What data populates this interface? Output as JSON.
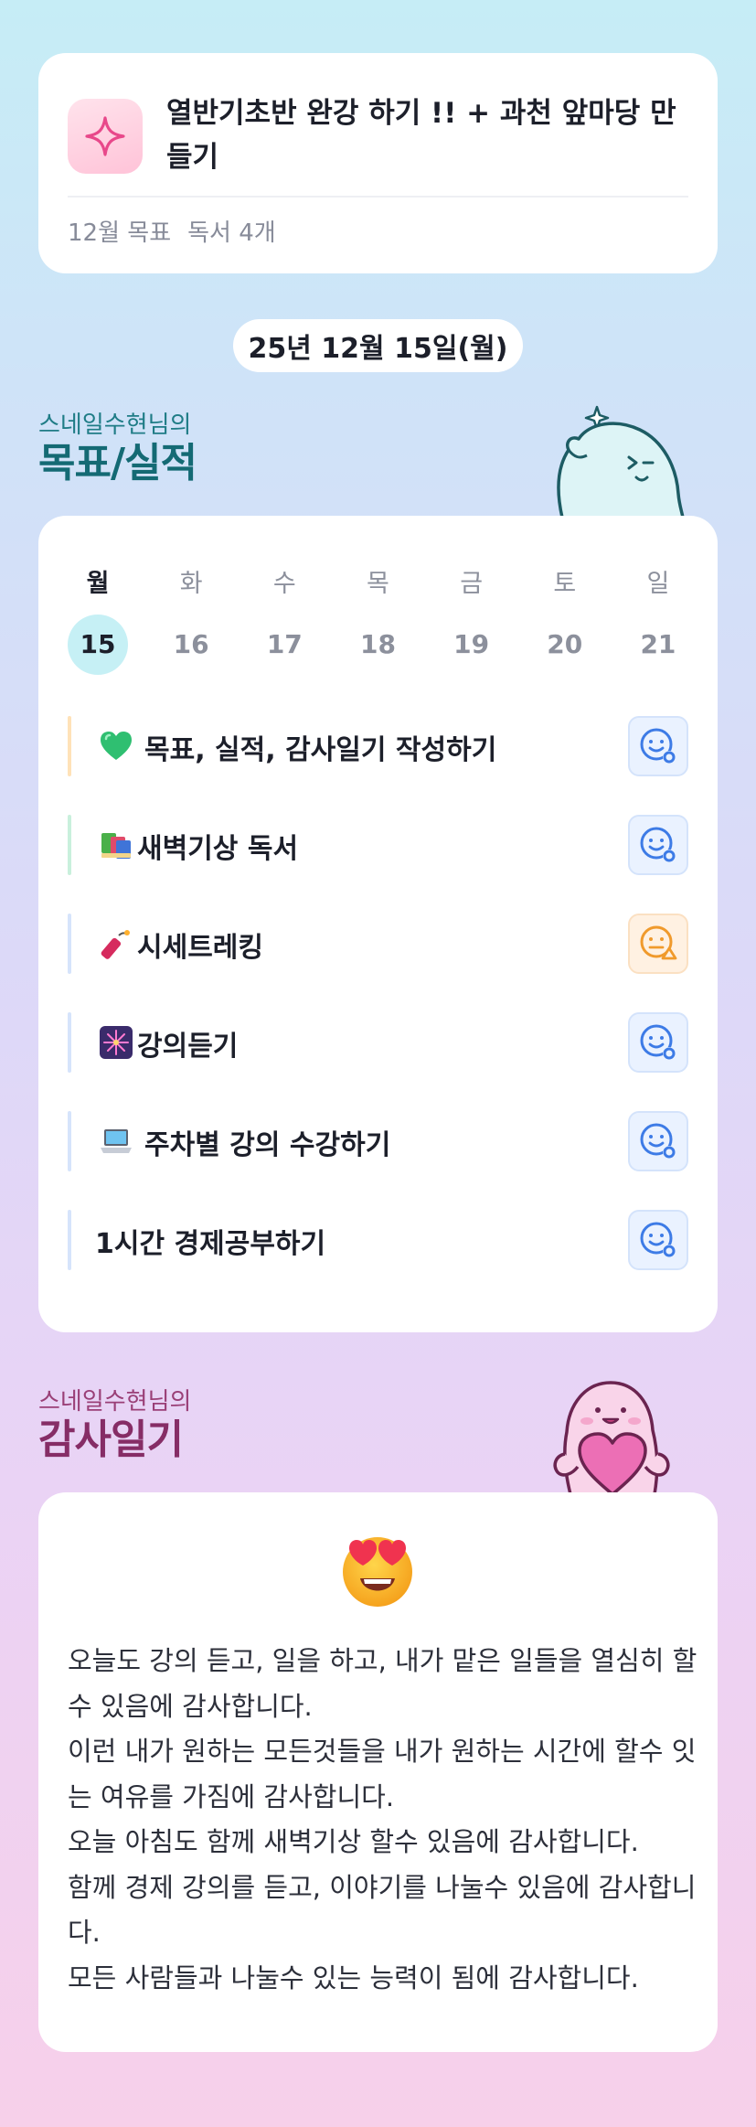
{
  "goal": {
    "icon": "sparkle-icon",
    "title": "열반기초반 완강 하기 !! + 과천 앞마당 만들기",
    "month_label": "12월 목표",
    "month_detail": "독서 4개"
  },
  "date_pill": "25년 12월 15일(월)",
  "goals_section": {
    "owner": "스네일수현님의",
    "title": "목표/실적",
    "weekdays": [
      "월",
      "화",
      "수",
      "목",
      "금",
      "토",
      "일"
    ],
    "dates": [
      "15",
      "16",
      "17",
      "18",
      "19",
      "20",
      "21"
    ],
    "active_index": 0,
    "tasks": [
      {
        "emoji": "green-heart-icon",
        "label": "목표, 실적, 감사일기 작성하기",
        "bar_color": "#ffe2b8",
        "status": "done"
      },
      {
        "emoji": "books-icon",
        "label": "새벽기상 독서",
        "bar_color": "#c9f0dc",
        "status": "done"
      },
      {
        "emoji": "firecracker-icon",
        "label": "시세트레킹",
        "bar_color": "#d6e4fb",
        "status": "warning"
      },
      {
        "emoji": "fireworks-icon",
        "label": "강의듣기",
        "bar_color": "#d6e4fb",
        "status": "done"
      },
      {
        "emoji": "laptop-icon",
        "label": "주차별 강의 수강하기",
        "bar_color": "#d6e4fb",
        "status": "done"
      },
      {
        "emoji": "",
        "label": "1시간 경제공부하기",
        "bar_color": "#d6e4fb",
        "status": "done"
      }
    ]
  },
  "thanks_section": {
    "owner": "스네일수현님의",
    "title": "감사일기",
    "emoji": "heart-eyes-icon",
    "lines": [
      "오늘도 강의 듣고, 일을 하고, 내가 맡은 일들을 열심히 할수 있음에 감사합니다.",
      "이런 내가 원하는 모든것들을 내가 원하는 시간에 할수 잇는 여유를 가짐에 감사합니다.",
      "오늘 아침도 함께 새벽기상 할수 있음에 감사합니다.",
      "함께 경제 강의를 듣고, 이야기를 나눌수 있음에 감사합니다.",
      "모든 사람들과 나눌수 있는 능력이 됨에 감사합니다."
    ]
  },
  "colors": {
    "goals_accent": "#146a74",
    "thanks_accent": "#862d66",
    "status_ok": "#3d7be6",
    "status_warn": "#f09a2c",
    "active_date_bg": "#c6f0f5"
  }
}
